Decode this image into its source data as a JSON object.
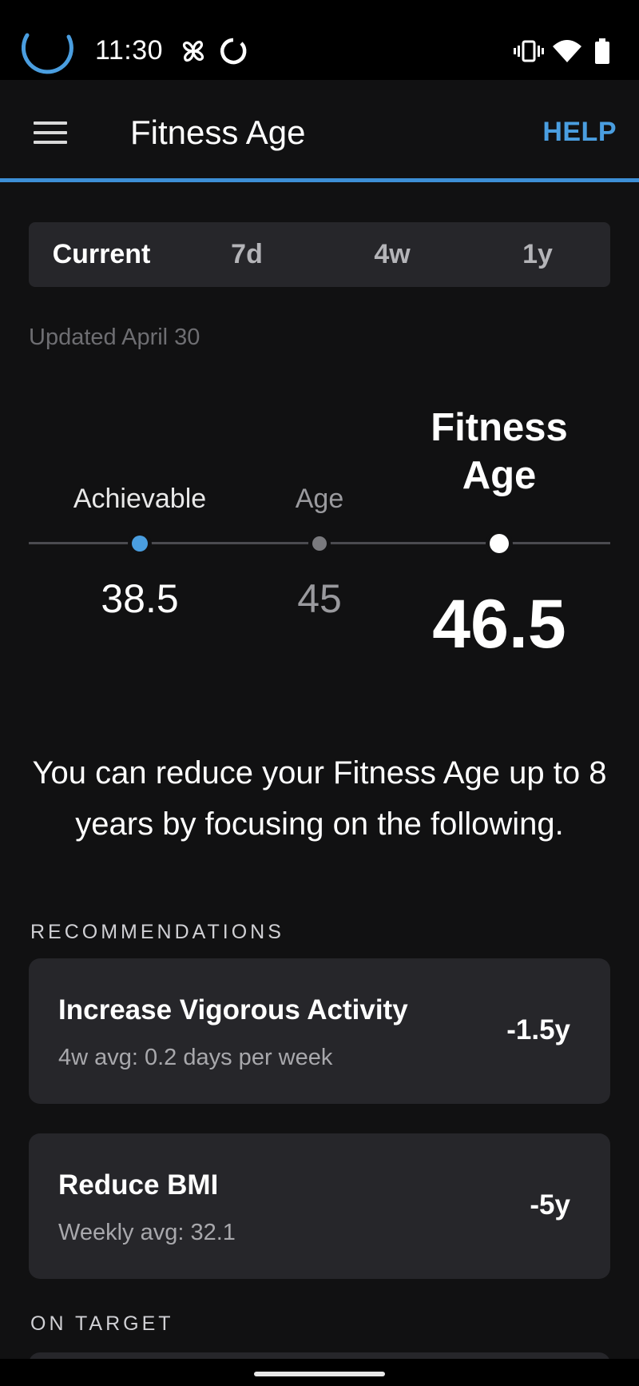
{
  "status_bar": {
    "time": "11:30",
    "icons": [
      "loading-spinner-icon",
      "pinwheel-icon",
      "circle-notification-icon",
      "vibrate-icon",
      "wifi-icon",
      "battery-icon"
    ]
  },
  "app_bar": {
    "title": "Fitness Age",
    "help_label": "HELP",
    "accent_color": "#3d8fd6"
  },
  "tabs": [
    {
      "label": "Current",
      "active": true
    },
    {
      "label": "7d",
      "active": false
    },
    {
      "label": "4w",
      "active": false
    },
    {
      "label": "1y",
      "active": false
    }
  ],
  "updated_text": "Updated April 30",
  "scale": {
    "achievable": {
      "label": "Achievable",
      "value": "38.5",
      "color": "#4a9ee0"
    },
    "age": {
      "label": "Age",
      "value": "45",
      "color": "#7a7a7e"
    },
    "fitness_age": {
      "label": "Fitness Age",
      "value": "46.5",
      "color": "#ffffff"
    }
  },
  "message": "You can reduce your Fitness Age up to 8 years by focusing on the following.",
  "recommendations": {
    "header": "RECOMMENDATIONS",
    "items": [
      {
        "title": "Increase Vigorous Activity",
        "subtitle": "4w avg: 0.2 days per week",
        "delta": "-1.5y"
      },
      {
        "title": "Reduce BMI",
        "subtitle": "Weekly avg: 32.1",
        "delta": "-5y"
      }
    ]
  },
  "on_target": {
    "header": "ON TARGET"
  }
}
